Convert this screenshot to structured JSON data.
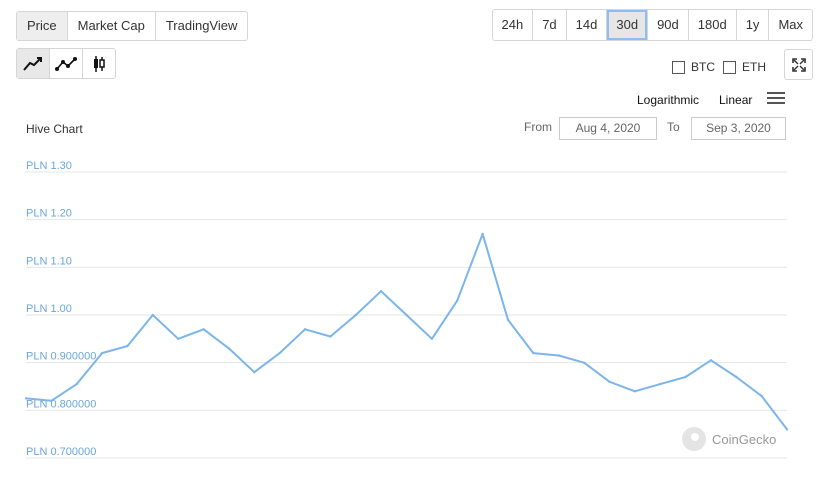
{
  "view_tabs": [
    "Price",
    "Market Cap",
    "TradingView"
  ],
  "range_tabs": [
    "24h",
    "7d",
    "14d",
    "30d",
    "90d",
    "180d",
    "1y",
    "Max"
  ],
  "active_range": "30d",
  "chart_types": [
    "line-chart-icon",
    "line-points-icon",
    "candlestick-icon"
  ],
  "checkboxes": {
    "btc": "BTC",
    "eth": "ETH"
  },
  "scale": {
    "log": "Logarithmic",
    "linear": "Linear"
  },
  "date_range": {
    "from_label": "From",
    "from": "Aug 4, 2020",
    "to_label": "To",
    "to": "Sep 3, 2020"
  },
  "watermark": "CoinGecko",
  "colors": {
    "line": "#7cb5ec",
    "tick_text": "#6aa6dc",
    "grid": "#e6e6e6"
  },
  "chart_data": {
    "type": "line",
    "title": "Hive Chart",
    "ylabel": "",
    "ylim": [
      0.68,
      1.32
    ],
    "yticks": [
      1.3,
      1.2,
      1.1,
      1.0,
      0.9,
      0.8,
      0.7
    ],
    "ytick_labels": [
      "PLN 1.30",
      "PLN 1.20",
      "PLN 1.10",
      "PLN 1.00",
      "PLN 0.900000",
      "PLN 0.800000",
      "PLN 0.700000"
    ],
    "x": [
      "2020-08-04",
      "2020-08-05",
      "2020-08-06",
      "2020-08-07",
      "2020-08-08",
      "2020-08-09",
      "2020-08-10",
      "2020-08-11",
      "2020-08-12",
      "2020-08-13",
      "2020-08-14",
      "2020-08-15",
      "2020-08-16",
      "2020-08-17",
      "2020-08-18",
      "2020-08-19",
      "2020-08-20",
      "2020-08-21",
      "2020-08-22",
      "2020-08-23",
      "2020-08-24",
      "2020-08-25",
      "2020-08-26",
      "2020-08-27",
      "2020-08-28",
      "2020-08-29",
      "2020-08-30",
      "2020-08-31",
      "2020-09-01",
      "2020-09-02",
      "2020-09-03"
    ],
    "series": [
      {
        "values": [
          0.825,
          0.82,
          0.855,
          0.92,
          0.935,
          1.0,
          0.95,
          0.97,
          0.93,
          0.88,
          0.92,
          0.97,
          0.955,
          1.0,
          1.05,
          1.0,
          0.95,
          1.03,
          1.17,
          0.99,
          0.92,
          0.915,
          0.9,
          0.86,
          0.84,
          0.855,
          0.87,
          0.905,
          0.87,
          0.83,
          0.76
        ]
      }
    ]
  }
}
